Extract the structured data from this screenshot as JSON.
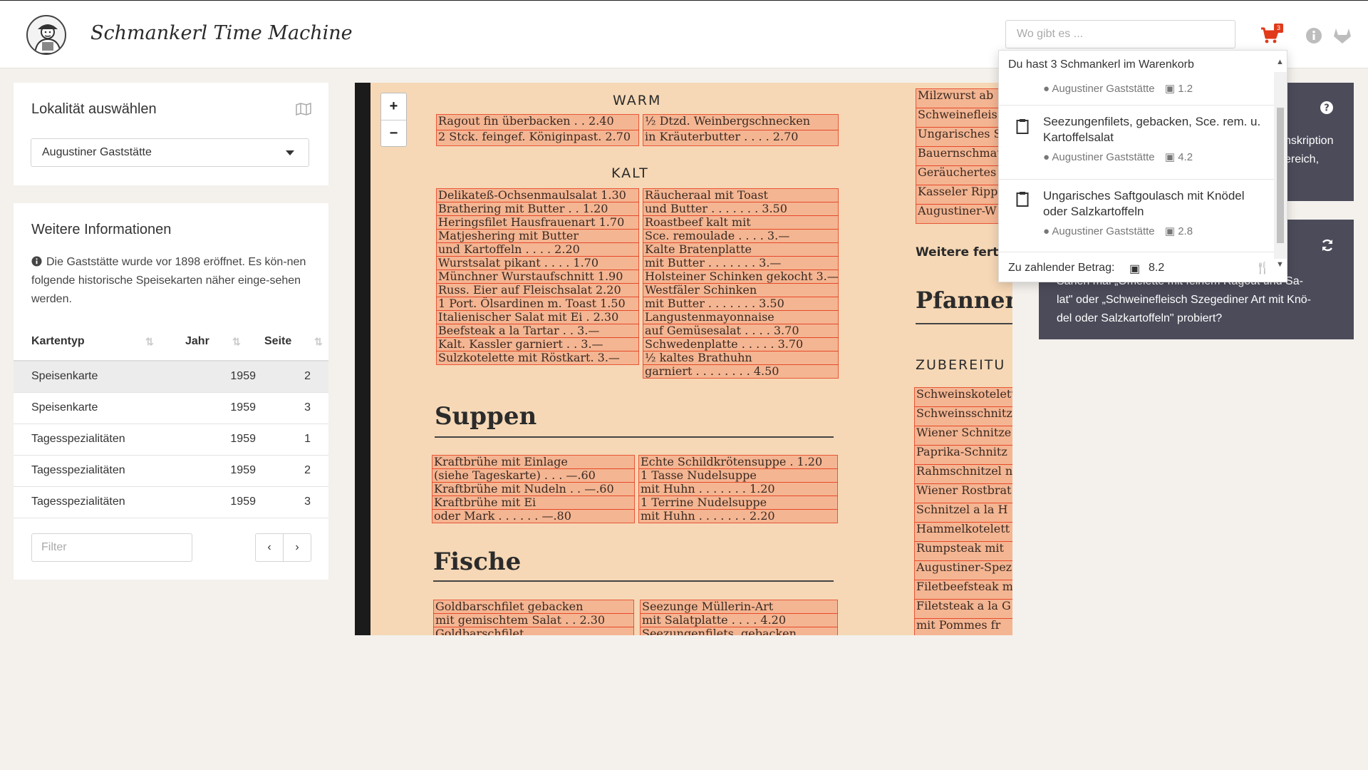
{
  "app": {
    "title": "Schmankerl Time Machine"
  },
  "search": {
    "placeholder": "Wo gibt es ..."
  },
  "cart": {
    "count": "3"
  },
  "locality": {
    "title": "Lokalität auswählen",
    "selected": "Augustiner Gaststätte"
  },
  "info": {
    "title": "Weitere Informationen",
    "text": "Die Gaststätte wurde vor 1898 eröffnet. Es kön-nen folgende historische Speisekarten näher einge-sehen werden.",
    "columns": [
      "Kartentyp",
      "Jahr",
      "Seite"
    ],
    "rows": [
      {
        "type": "Speisenkarte",
        "year": "1959",
        "page": "2"
      },
      {
        "type": "Speisenkarte",
        "year": "1959",
        "page": "3"
      },
      {
        "type": "Tagesspezialitäten",
        "year": "1959",
        "page": "1"
      },
      {
        "type": "Tagesspezialitäten",
        "year": "1959",
        "page": "2"
      },
      {
        "type": "Tagesspezialitäten",
        "year": "1959",
        "page": "3"
      }
    ],
    "filter_placeholder": "Filter"
  },
  "menu": {
    "warm": "WARM",
    "kalt": "KALT",
    "suppen": "Suppen",
    "fische": "Fische",
    "pfannen": "Pfanneng",
    "weitere": "Weitere ferti",
    "zubereit": "ZUBEREITU",
    "warm_left": [
      "Ragout fin überbacken . . 2.40",
      "2 Stck. feingef. Königinpast. 2.70"
    ],
    "warm_right": [
      "½ Dtzd. Weinbergschnecken",
      "in Kräuterbutter . . . . 2.70"
    ],
    "kalt_left": [
      "Delikateß-Ochsenmaulsalat 1.30",
      "Brathering mit Butter . . 1.20",
      "Heringsfilet Hausfrauenart 1.70",
      "Matjeshering mit Butter",
      "und Kartoffeln . . . . 2.20",
      "Wurstsalat pikant . . . . 1.70",
      "Münchner Wurstaufschnitt 1.90",
      "Russ. Eier auf Fleischsalat 2.20",
      "1 Port. Ölsardinen m. Toast 1.50",
      "Italienischer Salat mit Ei . 2.30",
      "Beefsteak a la Tartar . . 3.—",
      "Kalt. Kassler garniert . . 3.—",
      "Sulzkotelette mit Röstkart. 3.—"
    ],
    "kalt_right": [
      "Räucheraal mit Toast",
      "und Butter . . . . . . . 3.50",
      "Roastbeef kalt mit",
      "Sce. remoulade . . . . 3.—",
      "Kalte Bratenplatte",
      "mit Butter . . . . . . . 3.—",
      "Holsteiner Schinken gekocht 3.—",
      "Westfäler Schinken",
      "mit Butter . . . . . . . 3.50",
      "Langustenmayonnaise",
      "auf Gemüsesalat . . . . 3.70",
      "Schwedenplatte . . . . . 3.70",
      "½ kaltes Brathuhn",
      "garniert . . . . . . . . 4.50"
    ],
    "suppen_left": [
      "Kraftbrühe mit Einlage",
      "(siehe Tageskarte) . . . —.60",
      "Kraftbrühe mit Nudeln . . —.60",
      "Kraftbrühe mit Ei",
      "oder Mark . . . . . . —.80"
    ],
    "suppen_right": [
      "Echte Schildkrötensuppe . 1.20",
      "1 Tasse Nudelsuppe",
      "mit Huhn . . . . . . . 1.20",
      "1 Terrine Nudelsuppe",
      "mit Huhn . . . . . . . 2.20"
    ],
    "fische_left": [
      "Goldbarschfilet gebacken",
      "mit gemischtem Salat . . 2.30",
      "Goldbarschfilet"
    ],
    "fische_right": [
      "Seezunge Müllerin-Art",
      "mit Salatplatte . . . . 4.20",
      "Seezungenfilets, gebacken"
    ],
    "col3_top": [
      "Milzwurst ab",
      "Schweinefleis",
      "Ungarisches S",
      "Bauernschmau",
      "Geräuchertes",
      "Kasseler Ripp",
      "Augustiner-W"
    ],
    "col3_bottom": [
      "Schweinskotelett",
      "Schweinsschnitz",
      "Wiener Schnitze",
      "Paprika-Schnitz",
      "Rahmschnitzel n",
      "Wiener Rostbrat",
      "Schnitzel a la H",
      "Hammelkotelett",
      "Rumpsteak mit",
      "Augustiner-Spez",
      "Filetbeefsteak m",
      "Filetsteak a la G",
      "mit Pommes fr"
    ]
  },
  "cart_dropdown": {
    "header": "Du hast 3 Schmankerl im Warenkorb",
    "items": [
      {
        "name": "",
        "place": "Augustiner Gaststätte",
        "price": "1.2"
      },
      {
        "name": "Seezungenfilets, gebacken, Sce. rem. u. Kartoffelsalat",
        "place": "Augustiner Gaststätte",
        "price": "4.2"
      },
      {
        "name": "Ungarisches Saftgoulasch mit Knödel oder Salzkartoffeln",
        "place": "Augustiner Gaststätte",
        "price": "2.8"
      }
    ],
    "total_label": "Zu zahlender Betrag:",
    "total": "8.2"
  },
  "side_card_1": {
    "line1": "nskription",
    "line2": "ereich,"
  },
  "side_card_2": {
    "text_line1": "Sahen mal „Omelette mit feinem Ragout und Sa-",
    "text_line2": "lat\" oder „Schweinefleisch Szegediner Art mit Knö-",
    "text_line3": "del oder Salzkartoffeln\" probiert?"
  },
  "colors": {
    "accent": "#e03a1a",
    "dark_card": "#4b4b5a",
    "highlight": "#f25a37"
  }
}
